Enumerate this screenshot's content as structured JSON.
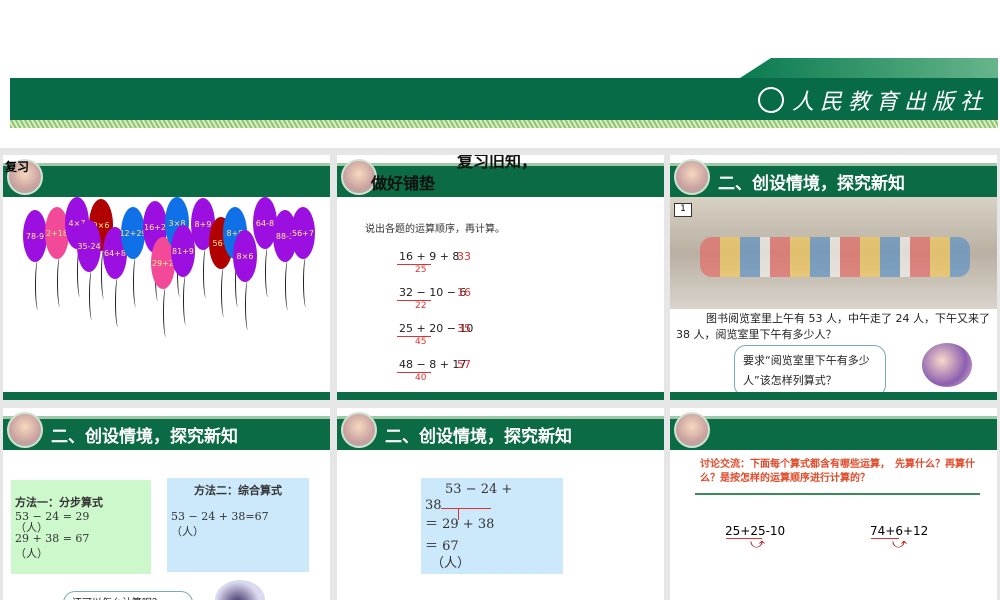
{
  "banner": {
    "publisher": "人民教育出版社"
  },
  "slides": [
    {
      "title": "复习",
      "balloons": [
        {
          "label": "78-9",
          "color": "#9b10e0"
        },
        {
          "label": "2+18",
          "color": "#f24a98"
        },
        {
          "label": "4×7",
          "color": "#9b10e0"
        },
        {
          "label": "9×6",
          "color": "#b00000"
        },
        {
          "label": "35-24",
          "color": "#9b10e0"
        },
        {
          "label": "64+8",
          "color": "#9b10e0"
        },
        {
          "label": "12+29",
          "color": "#1070e8"
        },
        {
          "label": "16+2",
          "color": "#9b10e0"
        },
        {
          "label": "29+2",
          "color": "#f24a98"
        },
        {
          "label": "3×8",
          "color": "#1070e8"
        },
        {
          "label": "81+9",
          "color": "#9b10e0"
        },
        {
          "label": "8+9",
          "color": "#9b10e0"
        },
        {
          "label": "56+",
          "color": "#b00000"
        },
        {
          "label": "8+8",
          "color": "#1070e8"
        },
        {
          "label": "8×6",
          "color": "#9b10e0"
        },
        {
          "label": "64-8",
          "color": "#9b10e0"
        },
        {
          "label": "88-3",
          "color": "#9b10e0"
        },
        {
          "label": "56+7",
          "color": "#9b10e0"
        }
      ]
    },
    {
      "title": "复习旧知，做好铺垫",
      "instruction": "说出各题的运算顺序，再计算。",
      "problems": [
        {
          "expr": "16 + 9 + 8",
          "step": "25",
          "answer": "33"
        },
        {
          "expr": "32 − 10 − 6",
          "step": "22",
          "answer": "16"
        },
        {
          "expr": "25 + 20 − 10",
          "step": "45",
          "answer": "35"
        },
        {
          "expr": "48 − 8 + 17",
          "step": "40",
          "answer": "57"
        }
      ]
    },
    {
      "title": "二、创设情境，探究新知",
      "badge": "1",
      "problem": "图书阅览室里上午有 53 人，中午走了 24 人，下午又来了 38 人，阅览室里下午有多少人？",
      "bubble": "要求“阅览室里下午有多少人”该怎样列算式？"
    },
    {
      "title": "二、创设情境，探究新知",
      "method1": {
        "title": "方法一：分步算式",
        "line1": "53 − 24 = 29",
        "unit1": "（人）",
        "line2": "29 + 38 = 67",
        "unit2": "（人）"
      },
      "method2": {
        "title": "方法二：综合算式",
        "line1": "53 − 24  + 38=67",
        "unit": "（人）"
      },
      "bubble": "还可以怎么计算呢？"
    },
    {
      "title": "二、创设情境，探究新知",
      "lines": [
        "53 − 24  +",
        "38",
        "＝ 29  + 38",
        "＝ 67",
        "（人）"
      ]
    },
    {
      "title": "",
      "discussion": "讨论交流：下面每个算式都含有哪些运算，　先算什么？再算什么？是按怎样的运算顺序进行计算的？",
      "expr1": "25+25-10",
      "expr2": "74+6+12"
    }
  ]
}
